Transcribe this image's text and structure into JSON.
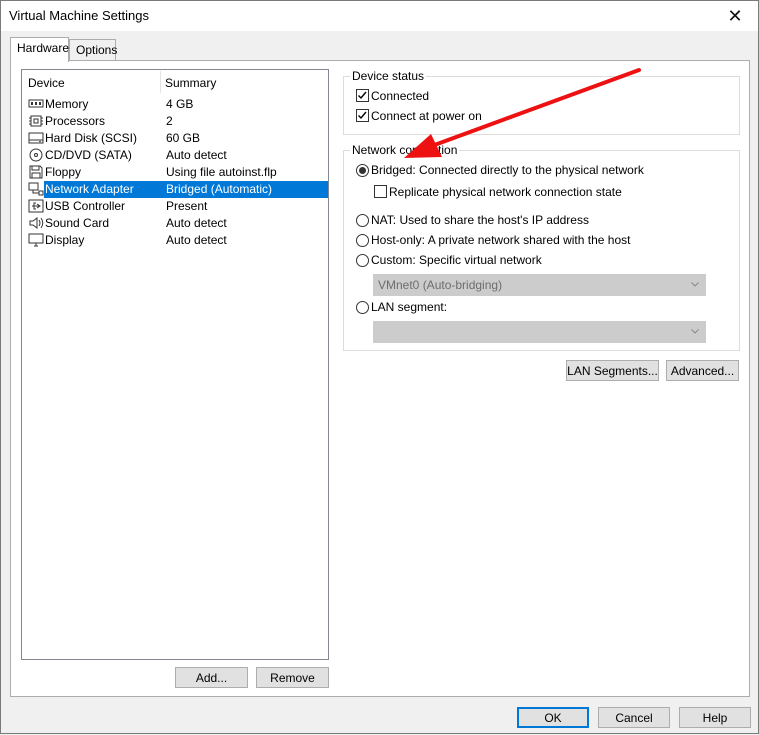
{
  "window": {
    "title": "Virtual Machine Settings",
    "close_glyph": "✕"
  },
  "tabs": [
    {
      "label": "Hardware",
      "active": true
    },
    {
      "label": "Options",
      "active": false
    }
  ],
  "device_list": {
    "headers": {
      "device": "Device",
      "summary": "Summary"
    },
    "rows": [
      {
        "name": "Memory",
        "summary": "4 GB",
        "icon": "memory-icon"
      },
      {
        "name": "Processors",
        "summary": "2",
        "icon": "cpu-icon"
      },
      {
        "name": "Hard Disk (SCSI)",
        "summary": "60 GB",
        "icon": "hard-disk-icon"
      },
      {
        "name": "CD/DVD (SATA)",
        "summary": "Auto detect",
        "icon": "cd-dvd-icon"
      },
      {
        "name": "Floppy",
        "summary": "Using file autoinst.flp",
        "icon": "floppy-icon"
      },
      {
        "name": "Network Adapter",
        "summary": "Bridged (Automatic)",
        "icon": "network-adapter-icon",
        "selected": true
      },
      {
        "name": "USB Controller",
        "summary": "Present",
        "icon": "usb-icon"
      },
      {
        "name": "Sound Card",
        "summary": "Auto detect",
        "icon": "speaker-icon"
      },
      {
        "name": "Display",
        "summary": "Auto detect",
        "icon": "monitor-icon"
      }
    ],
    "add_label": "Add...",
    "remove_label": "Remove"
  },
  "device_status": {
    "title": "Device status",
    "connected": {
      "label": "Connected",
      "checked": true
    },
    "connect_at_power_on": {
      "label": "Connect at power on",
      "checked": true
    }
  },
  "network_connection": {
    "title": "Network connection",
    "bridged": {
      "label": "Bridged: Connected directly to the physical network",
      "selected": true
    },
    "replicate": {
      "label": "Replicate physical network connection state",
      "checked": false
    },
    "nat": {
      "label": "NAT: Used to share the host's IP address",
      "selected": false
    },
    "host_only": {
      "label": "Host-only: A private network shared with the host",
      "selected": false
    },
    "custom": {
      "label": "Custom: Specific virtual network",
      "selected": false
    },
    "custom_combo_value": "VMnet0 (Auto-bridging)",
    "lan_segment": {
      "label": "LAN segment:",
      "selected": false
    },
    "lan_combo_value": "",
    "lan_segments_button": "LAN Segments...",
    "advanced_button": "Advanced..."
  },
  "footer": {
    "ok": "OK",
    "cancel": "Cancel",
    "help": "Help"
  },
  "colors": {
    "accent": "#0078d7",
    "annotation_arrow": "#ee1111"
  }
}
